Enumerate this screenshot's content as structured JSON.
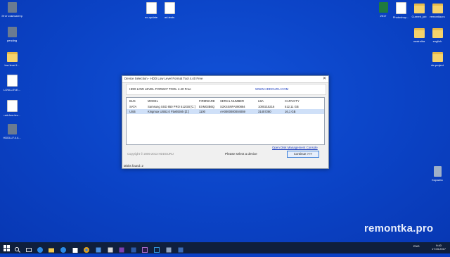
{
  "desktop": {
    "icons": [
      {
        "label": "Этот компьютер",
        "kind": "app"
      },
      {
        "label": "pending",
        "kind": "app"
      },
      {
        "label": "low level f...",
        "kind": "folder"
      },
      {
        "label": "LOW-LEVE...",
        "kind": "doc"
      },
      {
        "label": "usb-low-lev...",
        "kind": "doc"
      },
      {
        "label": "HDDLLF.4.4...",
        "kind": "app"
      },
      {
        "label": "no-update",
        "kind": "doc"
      },
      {
        "label": "ad-tests",
        "kind": "doc"
      },
      {
        "label": "2017",
        "kind": "excel"
      },
      {
        "label": "Photoshop...",
        "kind": "doc"
      },
      {
        "label": "Current_job",
        "kind": "folder"
      },
      {
        "label": "remontka.ru",
        "kind": "folder"
      },
      {
        "label": "nastroika",
        "kind": "folder"
      },
      {
        "label": "english",
        "kind": "folder"
      },
      {
        "label": "de-project",
        "kind": "folder"
      },
      {
        "label": "Корзина",
        "kind": "bin"
      }
    ]
  },
  "watermark": "remontka.pro",
  "dialog": {
    "title": "Device Selection - HDD Low Level Format Tool 4.40   Free",
    "close_glyph": "✕",
    "product": "HDD LOW LEVEL FORMAT TOOL 4.40    Free",
    "url": "WWW.HDDGURU.COM",
    "columns": {
      "bus": "BUS",
      "model": "MODEL",
      "firmware": "FIRMWARE",
      "serial": "SERIAL NUMBER",
      "lba": "LBA",
      "capacity": "CAPACITY"
    },
    "devices": [
      {
        "bus": "SATA",
        "model": "Samsung SSD 850 PRO 512GB [C:]",
        "firmware": "EXM03B6Q",
        "serial": "S3XSSNFA090884",
        "lba": "1000215216",
        "capacity": "512,11 GB"
      },
      {
        "bus": "USB",
        "model": "Kingmax USB2.0 FlashDisk [Z:]",
        "firmware": "1100",
        "serial": "AA0000000004059",
        "lba": "31457280",
        "capacity": "16,1 GB"
      }
    ],
    "disk_mgmt_link": "Open Disk Management Console",
    "copyright": "Copyright © 2005-2013 HDDGURU",
    "status": "Please select a device",
    "continue_label": "Continue >>>",
    "disks_found": "Disks found: 2"
  },
  "taskbar": {
    "tray_lang": "ENG",
    "time": "9:40",
    "date": "17.03.2017"
  },
  "colors": {
    "desktop": "#0b43c6",
    "taskbar": "#0f1f3c",
    "selection": "#cfe0f8",
    "link": "#1f3fbf"
  }
}
